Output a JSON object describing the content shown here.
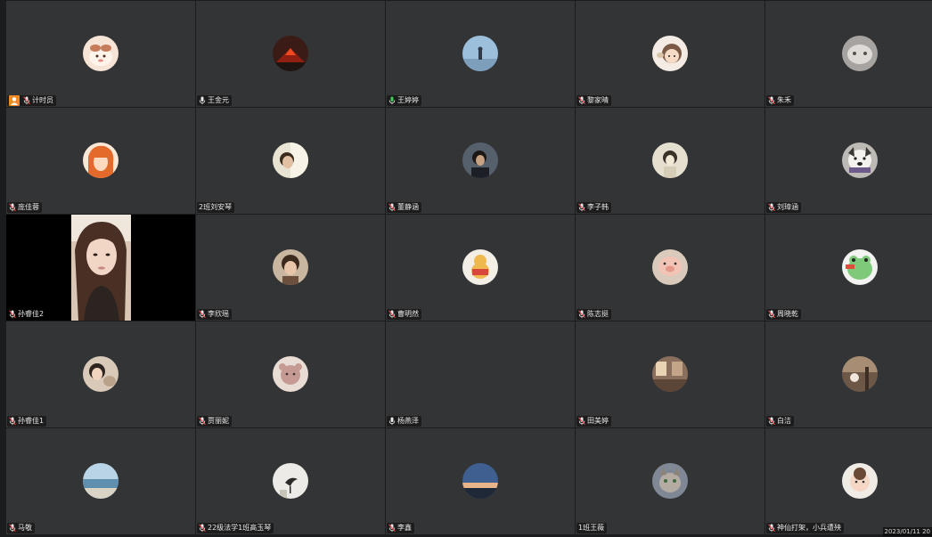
{
  "timestamp": "2023/01/11 20",
  "participants": [
    {
      "name": "计时员",
      "mic": "muted",
      "host_badge": true,
      "avatar": "avatar-cartoon-pink"
    },
    {
      "name": "王金元",
      "mic": "on",
      "avatar": "avatar-volcano"
    },
    {
      "name": "王婷婷",
      "mic": "speaking",
      "avatar": "avatar-sky-figure"
    },
    {
      "name": "黎家晴",
      "mic": "muted",
      "avatar": "avatar-cartoon-girl"
    },
    {
      "name": "朱禾",
      "mic": "muted",
      "avatar": "avatar-cat-gray"
    },
    {
      "name": "庞佳蓉",
      "mic": "muted",
      "avatar": "avatar-anime-orange"
    },
    {
      "name": "2班刘安琴",
      "mic": "none",
      "avatar": "avatar-portrait-light"
    },
    {
      "name": "董静涵",
      "mic": "muted",
      "avatar": "avatar-portrait-dark"
    },
    {
      "name": "李子韩",
      "mic": "muted",
      "avatar": "avatar-sketch"
    },
    {
      "name": "刘璋涵",
      "mic": "muted",
      "avatar": "avatar-dog"
    },
    {
      "name": "孙睿佳2",
      "mic": "muted",
      "video": true
    },
    {
      "name": "李欣瑶",
      "mic": "muted",
      "avatar": "avatar-portrait-boy"
    },
    {
      "name": "曹明然",
      "mic": "muted",
      "avatar": "avatar-pooh"
    },
    {
      "name": "陈志挺",
      "mic": "muted",
      "avatar": "avatar-pig"
    },
    {
      "name": "周晓乾",
      "mic": "muted",
      "avatar": "avatar-frog"
    },
    {
      "name": "孙睿佳1",
      "mic": "muted",
      "avatar": "avatar-girl-cat"
    },
    {
      "name": "贾丽妮",
      "mic": "muted",
      "avatar": "avatar-bear"
    },
    {
      "name": "杨燕泽",
      "mic": "on",
      "avatar": "none"
    },
    {
      "name": "田美婷",
      "mic": "muted",
      "avatar": "avatar-room"
    },
    {
      "name": "白洁",
      "mic": "muted",
      "avatar": "avatar-woods"
    },
    {
      "name": "马敬",
      "mic": "muted",
      "avatar": "avatar-sea"
    },
    {
      "name": "22级法学1班高玉琴",
      "mic": "muted",
      "avatar": "avatar-bird"
    },
    {
      "name": "李鑫",
      "mic": "muted",
      "avatar": "avatar-sunset"
    },
    {
      "name": "1班王薇",
      "mic": "none",
      "avatar": "avatar-cat-tabby"
    },
    {
      "name": "神仙打架，小兵遭殃",
      "mic": "muted",
      "avatar": "avatar-baby"
    }
  ]
}
